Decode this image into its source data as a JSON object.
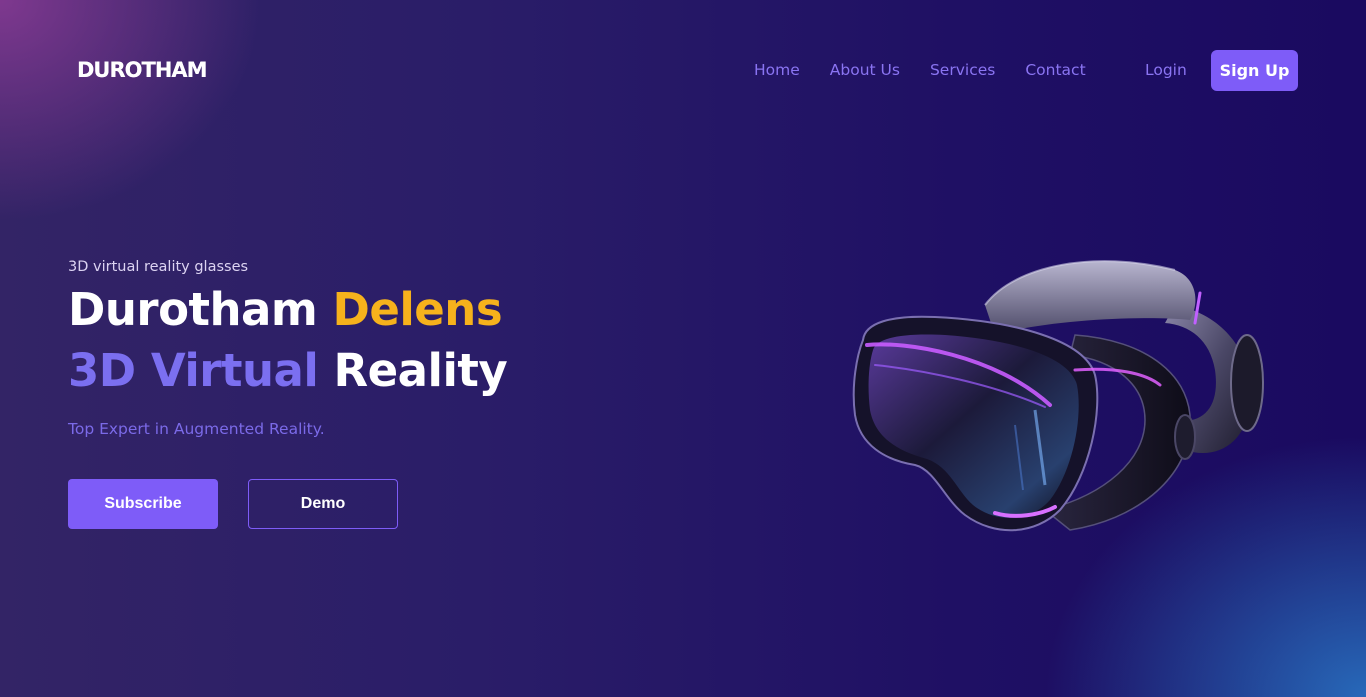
{
  "brand": {
    "logo": "DUROTHAM"
  },
  "nav": {
    "items": [
      {
        "label": "Home"
      },
      {
        "label": "About Us"
      },
      {
        "label": "Services"
      },
      {
        "label": "Contact"
      }
    ],
    "login_label": "Login",
    "signup_label": "Sign Up"
  },
  "hero": {
    "kicker": "3D virtual reality glasses",
    "headline_line1_part1": "Durotham",
    "headline_line1_part2": "Delens",
    "headline_line2_part1": "3D Virtual",
    "headline_line2_part2": "Reality",
    "tagline": "Top Expert in Augmented Reality.",
    "subscribe_label": "Subscribe",
    "demo_label": "Demo",
    "image_subject": "vr-headset-image"
  },
  "colors": {
    "accent": "#7e5cf8",
    "highlight": "#f6b21c",
    "nav_link": "#8a74f2",
    "background": "#231a62"
  }
}
